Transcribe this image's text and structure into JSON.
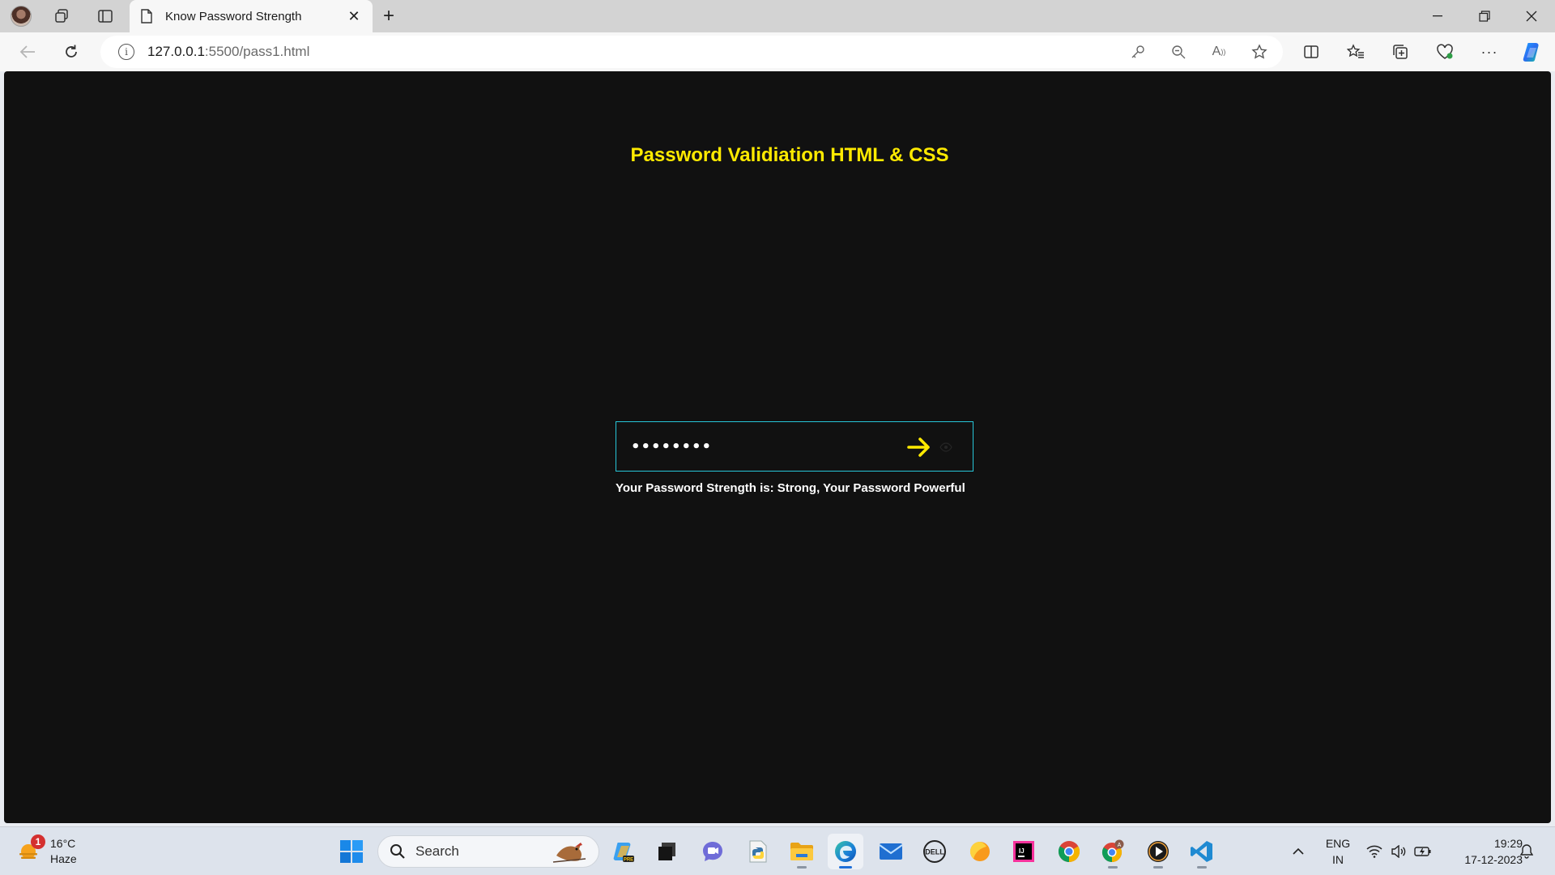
{
  "browser": {
    "tab_title": "Know Password Strength",
    "url_host": "127.0.0.1",
    "url_rest": ":5500/pass1.html"
  },
  "page": {
    "title": "Password Validiation HTML & CSS",
    "password_masked": "••••••••",
    "strength_message": "Your Password Strength is: Strong, Your Password Powerful",
    "colors": {
      "background": "#111111",
      "title": "#ffea00",
      "border": "#27c5d8",
      "arrow": "#ffea00"
    }
  },
  "taskbar": {
    "weather_temp": "16°C",
    "weather_desc": "Haze",
    "weather_badge": "1",
    "search_label": "Search",
    "lang_top": "ENG",
    "lang_bottom": "IN",
    "time": "19:29",
    "date": "17-12-2023"
  }
}
